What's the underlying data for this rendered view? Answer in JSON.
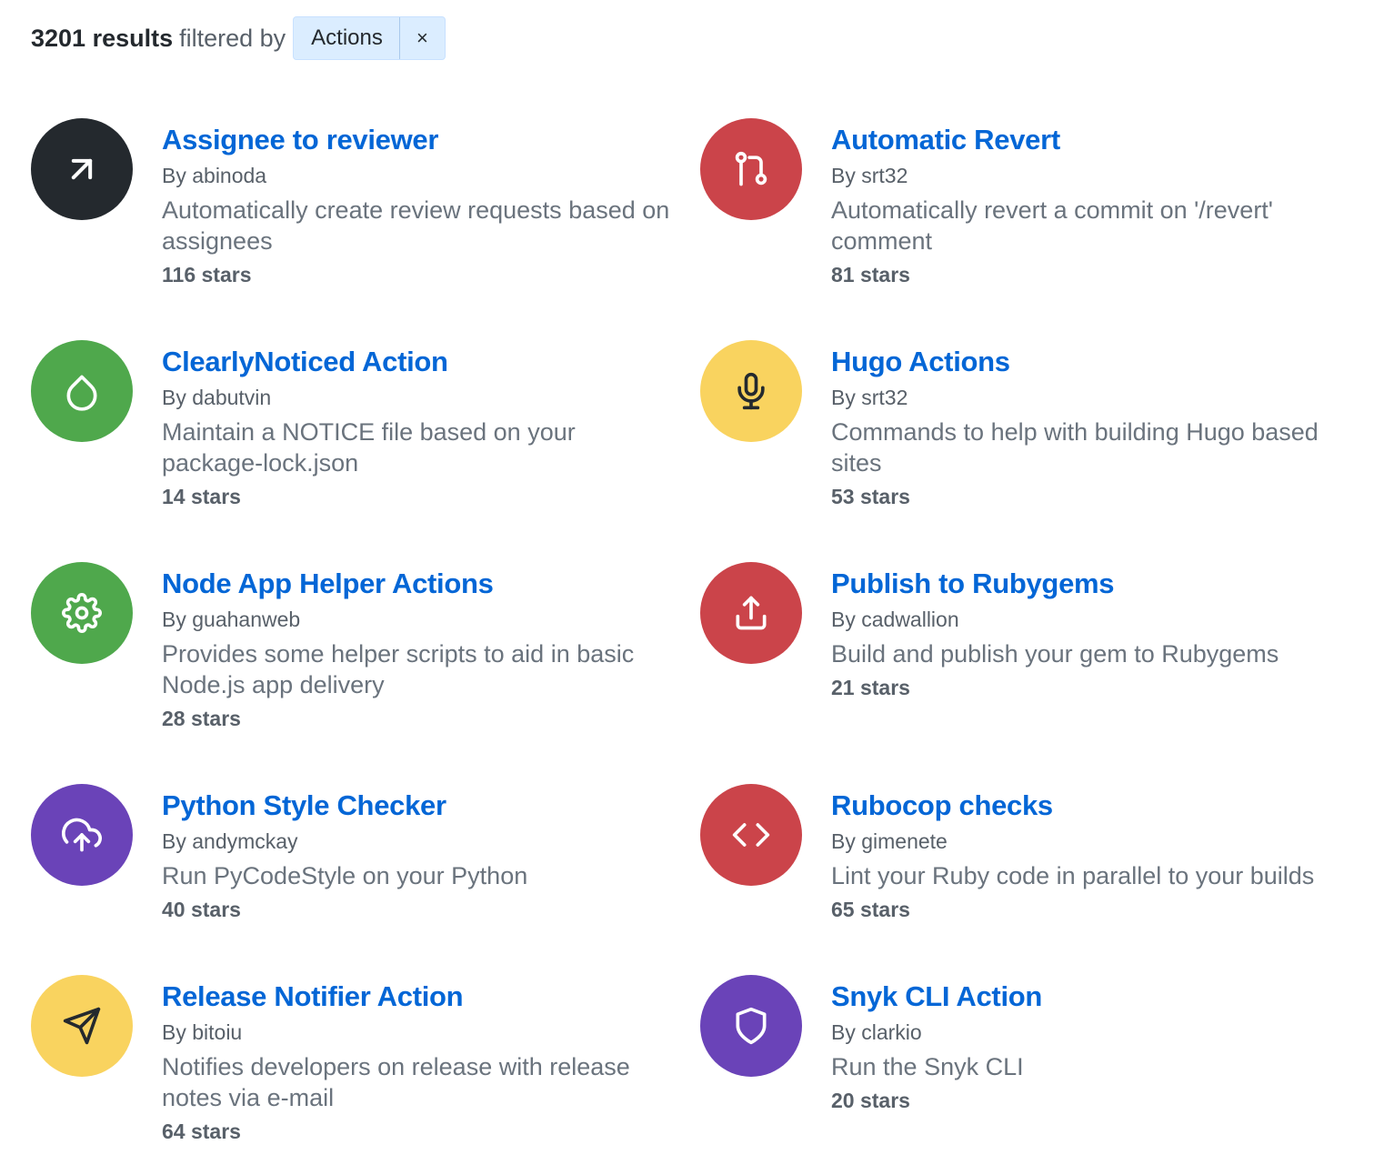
{
  "header": {
    "count": "3201 results",
    "filtered_by": "filtered by",
    "filter_label": "Actions",
    "filter_remove_label": "×"
  },
  "colors": {
    "dark": "#24292e",
    "red": "#cb444a",
    "green": "#4fa84c",
    "yellow": "#f9d35f",
    "purple": "#6a43b8",
    "link": "#0366d6"
  },
  "results": [
    {
      "title": "Assignee to reviewer",
      "author": "By abinoda",
      "description": "Automatically create review requests based on assignees",
      "stars": "116 stars",
      "icon": "arrow-up-right-icon",
      "bg": "#24292e",
      "fg": "#ffffff"
    },
    {
      "title": "Automatic Revert",
      "author": "By srt32",
      "description": "Automatically revert a commit on '/revert' comment",
      "stars": "81 stars",
      "icon": "git-pull-request-icon",
      "bg": "#cb444a",
      "fg": "#ffffff"
    },
    {
      "title": "ClearlyNoticed Action",
      "author": "By dabutvin",
      "description": "Maintain a NOTICE file based on your package-lock.json",
      "stars": "14 stars",
      "icon": "droplet-icon",
      "bg": "#4fa84c",
      "fg": "#ffffff"
    },
    {
      "title": "Hugo Actions",
      "author": "By srt32",
      "description": "Commands to help with building Hugo based sites",
      "stars": "53 stars",
      "icon": "microphone-icon",
      "bg": "#f9d35f",
      "fg": "#24292e"
    },
    {
      "title": "Node App Helper Actions",
      "author": "By guahanweb",
      "description": "Provides some helper scripts to aid in basic Node.js app delivery",
      "stars": "28 stars",
      "icon": "gear-icon",
      "bg": "#4fa84c",
      "fg": "#ffffff"
    },
    {
      "title": "Publish to Rubygems",
      "author": "By cadwallion",
      "description": "Build and publish your gem to Rubygems",
      "stars": "21 stars",
      "icon": "upload-icon",
      "bg": "#cb444a",
      "fg": "#ffffff"
    },
    {
      "title": "Python Style Checker",
      "author": "By andymckay",
      "description": "Run PyCodeStyle on your Python",
      "stars": "40 stars",
      "icon": "cloud-upload-icon",
      "bg": "#6a43b8",
      "fg": "#ffffff"
    },
    {
      "title": "Rubocop checks",
      "author": "By gimenete",
      "description": "Lint your Ruby code in parallel to your builds",
      "stars": "65 stars",
      "icon": "code-icon",
      "bg": "#cb444a",
      "fg": "#ffffff"
    },
    {
      "title": "Release Notifier Action",
      "author": "By bitoiu",
      "description": "Notifies developers on release with release notes via e-mail",
      "stars": "64 stars",
      "icon": "send-icon",
      "bg": "#f9d35f",
      "fg": "#24292e"
    },
    {
      "title": "Snyk CLI Action",
      "author": "By clarkio",
      "description": "Run the Snyk CLI",
      "stars": "20 stars",
      "icon": "shield-icon",
      "bg": "#6a43b8",
      "fg": "#ffffff"
    }
  ]
}
